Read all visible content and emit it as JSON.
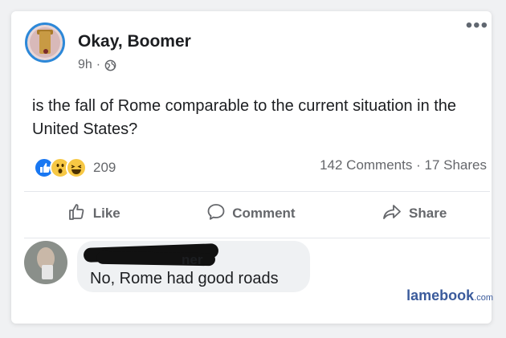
{
  "post": {
    "author": "Okay, Boomer",
    "time": "9h",
    "separator": "·",
    "text": "is the fall of Rome comparable to the current situation in the United States?",
    "reaction_count": "209",
    "comments": "142 Comments",
    "stats_separator": "·",
    "shares": "17 Shares"
  },
  "actions": {
    "like": "Like",
    "comment": "Comment",
    "share": "Share"
  },
  "comment": {
    "author_visible_fragment": "ner",
    "text": "No, Rome had good roads"
  },
  "watermark": {
    "brand": "lamebook",
    "suffix": ".com"
  },
  "colors": {
    "facebook_blue": "#1877f2",
    "muted_text": "#65676b",
    "bubble_bg": "#eff1f3"
  }
}
